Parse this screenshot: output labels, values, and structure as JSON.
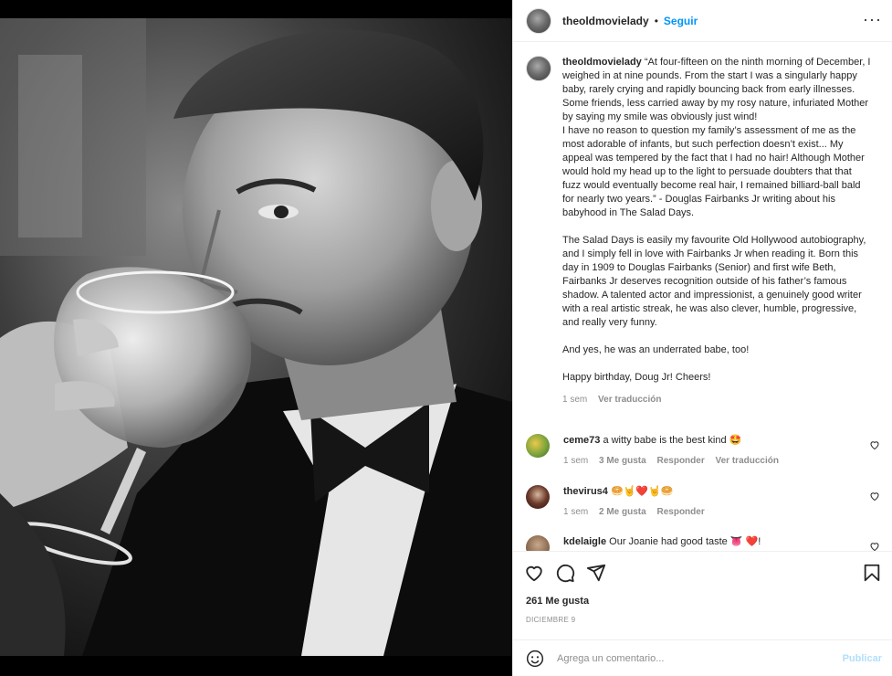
{
  "post": {
    "username": "theoldmovielady",
    "follow_label": "Seguir",
    "more_label": "···",
    "separator": "•"
  },
  "caption": {
    "username": "theoldmovielady",
    "paragraph1": "“At four-fifteen on the ninth morning of December, I weighed in at nine pounds. From the start I was a singularly happy baby, rarely crying and rapidly bouncing back from early illnesses. Some friends, less carried away by my rosy nature, infuriated Mother by saying my smile was obviously just wind!",
    "paragraph2": "I have no reason to question my family’s assessment of me as the most adorable of infants, but such perfection doesn’t exist... My appeal was tempered by the fact that I had no hair! Although Mother would hold my head up to the light to persuade doubters that that fuzz would eventually become real hair, I remained billiard-ball bald for nearly two years.” - Douglas Fairbanks Jr writing about his babyhood in The Salad Days.",
    "paragraph3": "The Salad Days is easily my favourite Old Hollywood autobiography, and I simply fell in love with Fairbanks Jr when reading it. Born this day in 1909 to Douglas Fairbanks (Senior) and first wife Beth, Fairbanks Jr deserves recognition outside of his father’s famous shadow. A talented actor and impressionist, a genuinely good writer with a real artistic streak, he was also clever, humble, progressive, and really very funny.",
    "paragraph4": "And yes, he was an underrated babe, too!",
    "paragraph5": "Happy birthday, Doug Jr! Cheers!",
    "time": "1 sem",
    "translate": "Ver traducción"
  },
  "comments": [
    {
      "username": "ceme73",
      "text": "a witty babe is the best kind 🤩",
      "time": "1 sem",
      "likes": "3 Me gusta",
      "reply": "Responder",
      "translate": "Ver traducción"
    },
    {
      "username": "thevirus4",
      "text": "🥯🤘❤️🤘🥯",
      "time": "1 sem",
      "likes": "2 Me gusta",
      "reply": "Responder"
    },
    {
      "username": "kdelaigle",
      "text": "Our Joanie had good taste 👅 ❤️!"
    }
  ],
  "footer": {
    "likes": "261 Me gusta",
    "date": "DICIEMBRE 9",
    "comment_placeholder": "Agrega un comentario...",
    "publish_label": "Publicar"
  },
  "colors": {
    "link_blue": "#0095f6",
    "publish_disabled": "#b2dffc",
    "meta_gray": "#8e8e8e"
  },
  "icons": [
    "heart-icon",
    "comment-icon",
    "share-icon",
    "save-icon",
    "emoji-icon",
    "more-icon"
  ]
}
